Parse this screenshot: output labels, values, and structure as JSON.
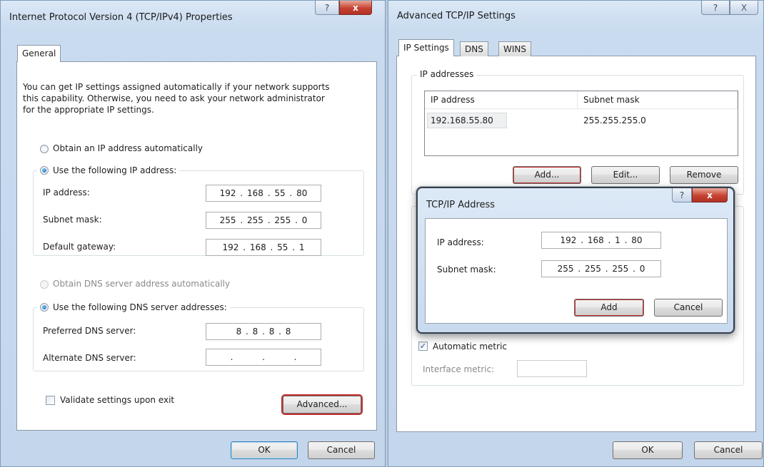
{
  "left": {
    "title": "Internet Protocol Version 4 (TCP/IPv4) Properties",
    "help_glyph": "?",
    "close_glyph": "x",
    "tab_general": "General",
    "intro": [
      "You can get IP settings assigned automatically if your network supports",
      "this capability. Otherwise, you need to ask your network administrator",
      "for the appropriate IP settings."
    ],
    "radio_obtain_ip": "Obtain an IP address automatically",
    "radio_use_ip": "Use the following IP address:",
    "ip_label": "IP address:",
    "ip_value": "192 . 168 . 55 . 80",
    "subnet_label": "Subnet mask:",
    "subnet_value": "255 . 255 . 255 . 0",
    "gateway_label": "Default gateway:",
    "gateway_value": "192 . 168 . 55 . 1",
    "radio_obtain_dns": "Obtain DNS server address automatically",
    "radio_use_dns": "Use the following DNS server addresses:",
    "preferred_dns_label": "Preferred DNS server:",
    "preferred_dns_value": "8 . 8 . 8 . 8",
    "alternate_dns_label": "Alternate DNS server:",
    "alternate_dns_value": ".       .       .",
    "validate_label": "Validate settings upon exit",
    "advanced_button": "Advanced...",
    "ok_button": "OK",
    "cancel_button": "Cancel"
  },
  "right": {
    "title": "Advanced TCP/IP Settings",
    "help_glyph": "?",
    "close_glyph": "X",
    "tabs": [
      "IP Settings",
      "DNS",
      "WINS"
    ],
    "ip_addresses_group": "IP addresses",
    "col_ip": "IP address",
    "col_mask": "Subnet mask",
    "row_ip": "192.168.55.80",
    "row_mask": "255.255.255.0",
    "add_button": "Add...",
    "edit_button": "Edit...",
    "remove_button": "Remove",
    "automatic_metric": "Automatic metric",
    "interface_metric_label": "Interface metric:",
    "ok_button": "OK",
    "cancel_button": "Cancel"
  },
  "dialog": {
    "title": "TCP/IP Address",
    "help_glyph": "?",
    "close_glyph": "x",
    "ip_label": "IP address:",
    "ip_value": "192 . 168 .  1  . 80",
    "subnet_label": "Subnet mask:",
    "subnet_value": "255 . 255 . 255 . 0",
    "add_button": "Add",
    "cancel_button": "Cancel"
  },
  "colors": {
    "highlight": "#c42b2b",
    "close_red": "#c64232",
    "frame_blue": "#c4d6ec"
  }
}
